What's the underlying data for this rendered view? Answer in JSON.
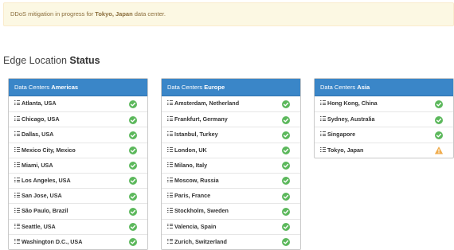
{
  "alert": {
    "prefix": "DDoS mitigation in progress for ",
    "location": "Tokyo, Japan",
    "suffix": " data center."
  },
  "heading": {
    "light": "Edge Location ",
    "bold": "Status"
  },
  "colors": {
    "ok": "#5cb85c",
    "warning": "#f0ad4e",
    "panel_header": "#3a86c8",
    "alert_bg": "#fcf8e3"
  },
  "regions": [
    {
      "prefix": "Data Centers ",
      "name": "Americas",
      "locations": [
        {
          "name": "Atlanta, USA",
          "status": "ok"
        },
        {
          "name": "Chicago, USA",
          "status": "ok"
        },
        {
          "name": "Dallas, USA",
          "status": "ok"
        },
        {
          "name": "Mexico City, Mexico",
          "status": "ok"
        },
        {
          "name": "Miami, USA",
          "status": "ok"
        },
        {
          "name": "Los Angeles, USA",
          "status": "ok"
        },
        {
          "name": "San Jose, USA",
          "status": "ok"
        },
        {
          "name": "São Paulo, Brazil",
          "status": "ok"
        },
        {
          "name": "Seattle, USA",
          "status": "ok"
        },
        {
          "name": "Washington D.C., USA",
          "status": "ok"
        }
      ]
    },
    {
      "prefix": "Data Centers ",
      "name": "Europe",
      "locations": [
        {
          "name": "Amsterdam, Netherland",
          "status": "ok"
        },
        {
          "name": "Frankfurt, Germany",
          "status": "ok"
        },
        {
          "name": "Istanbul, Turkey",
          "status": "ok"
        },
        {
          "name": "London, UK",
          "status": "ok"
        },
        {
          "name": "Milano, Italy",
          "status": "ok"
        },
        {
          "name": "Moscow, Russia",
          "status": "ok"
        },
        {
          "name": "Paris, France",
          "status": "ok"
        },
        {
          "name": "Stockholm, Sweden",
          "status": "ok"
        },
        {
          "name": "Valencia, Spain",
          "status": "ok"
        },
        {
          "name": "Zurich, Switzerland",
          "status": "ok"
        }
      ]
    },
    {
      "prefix": "Data Centers ",
      "name": "Asia",
      "locations": [
        {
          "name": "Hong Kong, China",
          "status": "ok"
        },
        {
          "name": "Sydney, Australia",
          "status": "ok"
        },
        {
          "name": "Singapore",
          "status": "ok"
        },
        {
          "name": "Tokyo, Japan",
          "status": "warning"
        }
      ]
    }
  ]
}
